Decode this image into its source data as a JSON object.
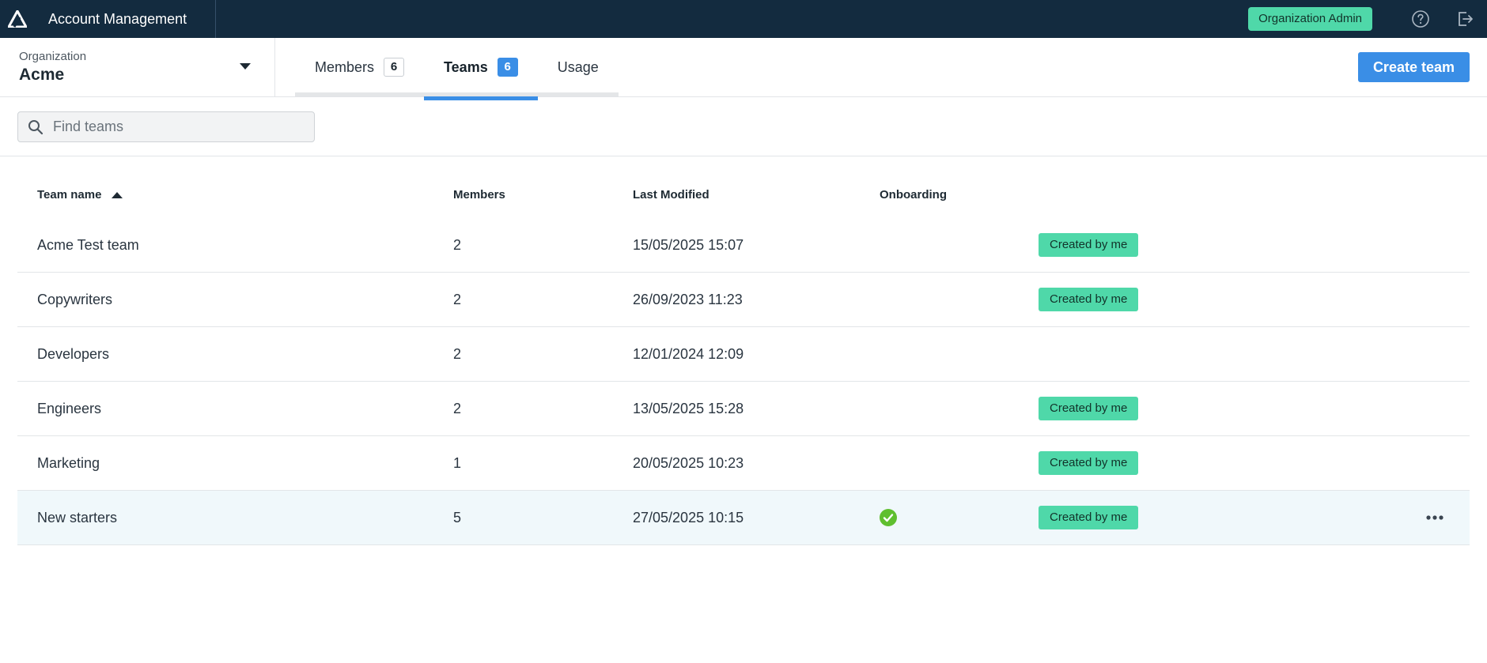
{
  "topbar": {
    "app_title": "Account Management",
    "role_badge": "Organization Admin",
    "logo_icon": "app-logo-icon",
    "help_icon": "help-icon",
    "logout_icon": "logout-icon"
  },
  "organization": {
    "caption": "Organization",
    "name": "Acme"
  },
  "tabs": [
    {
      "label": "Members",
      "count": "6",
      "active": false
    },
    {
      "label": "Teams",
      "count": "6",
      "active": true
    },
    {
      "label": "Usage",
      "count": "",
      "active": false
    }
  ],
  "create_button": "Create team",
  "search": {
    "placeholder": "Find teams",
    "value": ""
  },
  "table": {
    "columns": {
      "name": "Team name",
      "members": "Members",
      "modified": "Last Modified",
      "onboarding": "Onboarding"
    },
    "sort": {
      "column": "name",
      "direction": "ascending"
    },
    "rows": [
      {
        "name": "Acme Test team",
        "members": "2",
        "modified": "15/05/2025 15:07",
        "onboarding": false,
        "tag": "Created by me"
      },
      {
        "name": "Copywriters",
        "members": "2",
        "modified": "26/09/2023 11:23",
        "onboarding": false,
        "tag": "Created by me"
      },
      {
        "name": "Developers",
        "members": "2",
        "modified": "12/01/2024 12:09",
        "onboarding": false,
        "tag": ""
      },
      {
        "name": "Engineers",
        "members": "2",
        "modified": "13/05/2025 15:28",
        "onboarding": false,
        "tag": "Created by me"
      },
      {
        "name": "Marketing",
        "members": "1",
        "modified": "20/05/2025 10:23",
        "onboarding": false,
        "tag": "Created by me"
      },
      {
        "name": "New starters",
        "members": "5",
        "modified": "27/05/2025 10:15",
        "onboarding": true,
        "tag": "Created by me"
      }
    ]
  },
  "colors": {
    "topbar": "#132b3f",
    "accent": "#3a8ee6",
    "tag": "#4fd8a9",
    "check": "#5fbf2f",
    "row_highlight": "#f0f8fb"
  }
}
